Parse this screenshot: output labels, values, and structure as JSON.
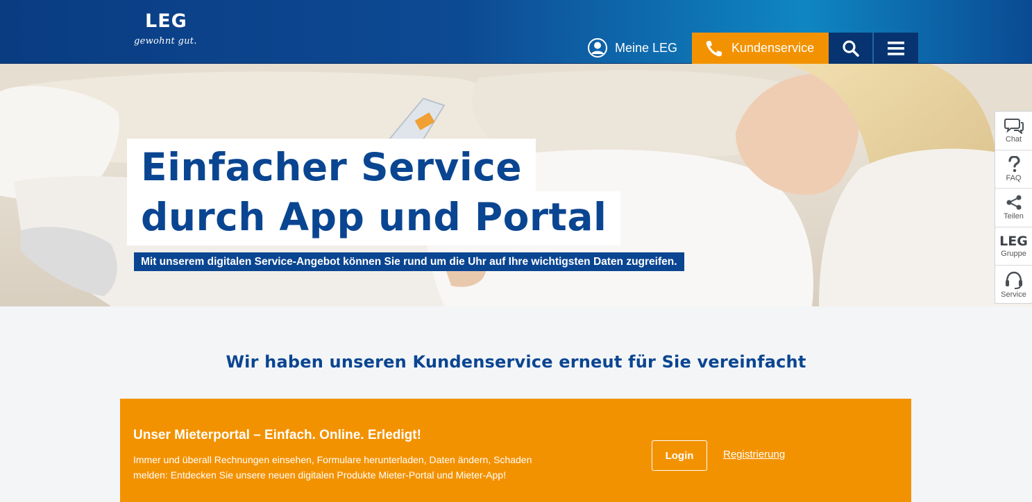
{
  "header": {
    "logo": {
      "mark": "LEG",
      "claim": "gewohnt gut."
    },
    "nav": {
      "meine_leg": "Meine LEG",
      "kundenservice": "Kundenservice",
      "search_icon": "search-icon",
      "menu_icon": "hamburger-menu-icon"
    },
    "colors": {
      "primary": "#0a4591",
      "accent": "#f39200",
      "dark": "#073470"
    }
  },
  "hero": {
    "title_line1": "Einfacher Service",
    "title_line2": "durch App und Portal",
    "subtitle": "Mit unserem digitalen Service-Angebot können Sie rund um die Uhr auf Ihre wichtigsten Daten zugreifen."
  },
  "sidebar": {
    "items": [
      {
        "label": "Chat",
        "icon": "chat-icon"
      },
      {
        "label": "FAQ",
        "icon": "question-icon"
      },
      {
        "label": "Teilen",
        "icon": "share-icon"
      },
      {
        "label": "Gruppe",
        "mark": "LEG"
      },
      {
        "label": "Service",
        "icon": "headset-icon"
      }
    ]
  },
  "main": {
    "section_title": "Wir haben unseren Kundenservice erneut für Sie vereinfacht",
    "promo": {
      "title": "Unser Mieterportal – Einfach. Online. Erledigt!",
      "text": "Immer und überall Rechnungen einsehen, Formulare herunterladen, Daten ändern, Schaden melden: Entdecken Sie unsere neuen digitalen Produkte Mieter-Portal und Mieter-App!",
      "login_label": "Login",
      "register_label": "Registrierung"
    }
  }
}
